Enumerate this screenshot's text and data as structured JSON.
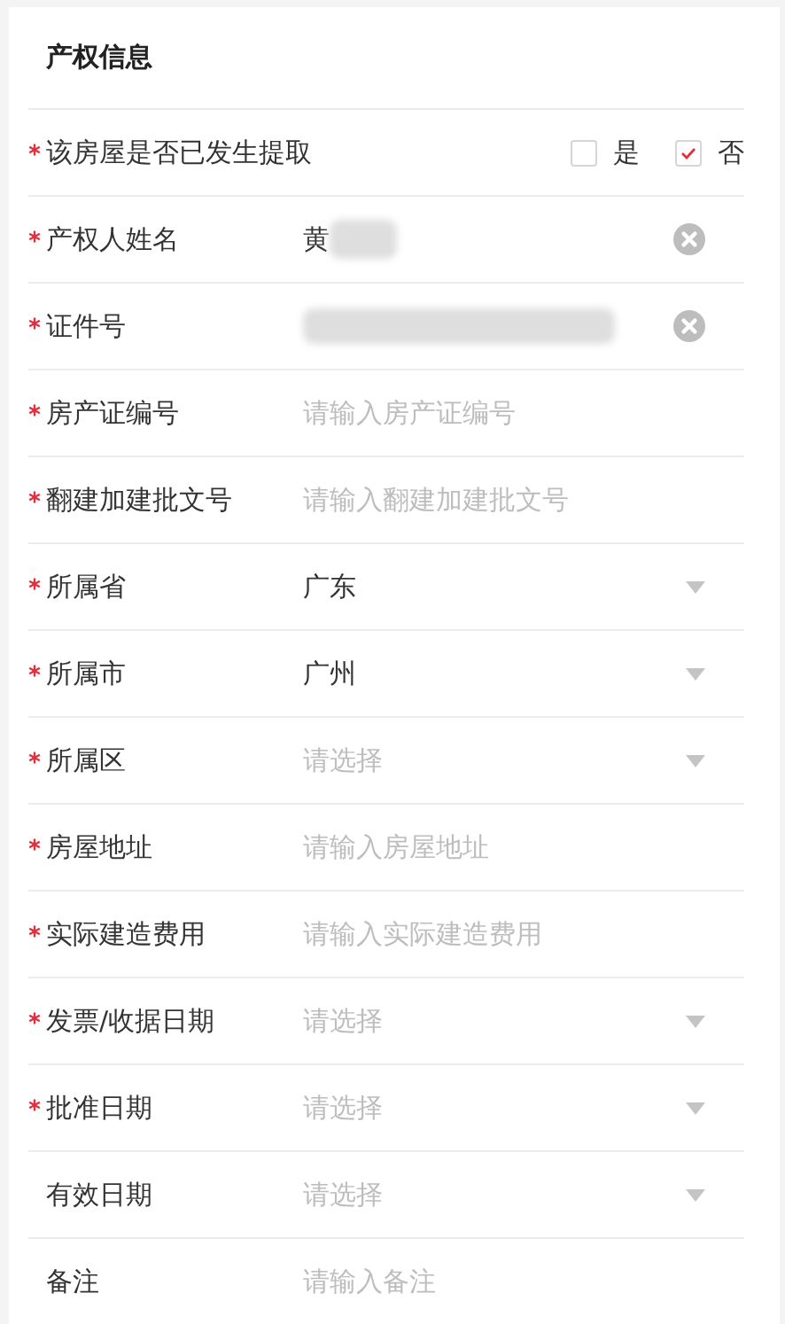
{
  "section": {
    "title": "产权信息"
  },
  "fields": [
    {
      "kind": "choice",
      "label": "该房屋是否已发生提取",
      "required": true,
      "options": [
        {
          "label": "是",
          "checked": false
        },
        {
          "label": "否",
          "checked": true
        }
      ]
    },
    {
      "kind": "clearable",
      "label": "产权人姓名",
      "required": true,
      "value": "黄",
      "redacted": true
    },
    {
      "kind": "clearable",
      "label": "证件号",
      "required": true,
      "redacted": true
    },
    {
      "kind": "input",
      "label": "房产证编号",
      "required": true,
      "placeholder": "请输入房产证编号"
    },
    {
      "kind": "input",
      "label": "翻建加建批文号",
      "required": true,
      "placeholder": "请输入翻建加建批文号"
    },
    {
      "kind": "select",
      "label": "所属省",
      "required": true,
      "value": "广东"
    },
    {
      "kind": "select",
      "label": "所属市",
      "required": true,
      "value": "广州"
    },
    {
      "kind": "select",
      "label": "所属区",
      "required": true,
      "placeholder": "请选择"
    },
    {
      "kind": "input",
      "label": "房屋地址",
      "required": true,
      "placeholder": "请输入房屋地址"
    },
    {
      "kind": "input",
      "label": "实际建造费用",
      "required": true,
      "placeholder": "请输入实际建造费用"
    },
    {
      "kind": "select",
      "label": "发票/收据日期",
      "required": true,
      "placeholder": "请选择"
    },
    {
      "kind": "select",
      "label": "批准日期",
      "required": true,
      "placeholder": "请选择"
    },
    {
      "kind": "select",
      "label": "有效日期",
      "required": false,
      "placeholder": "请选择"
    },
    {
      "kind": "input",
      "label": "备注",
      "required": false,
      "placeholder": "请输入备注"
    }
  ]
}
